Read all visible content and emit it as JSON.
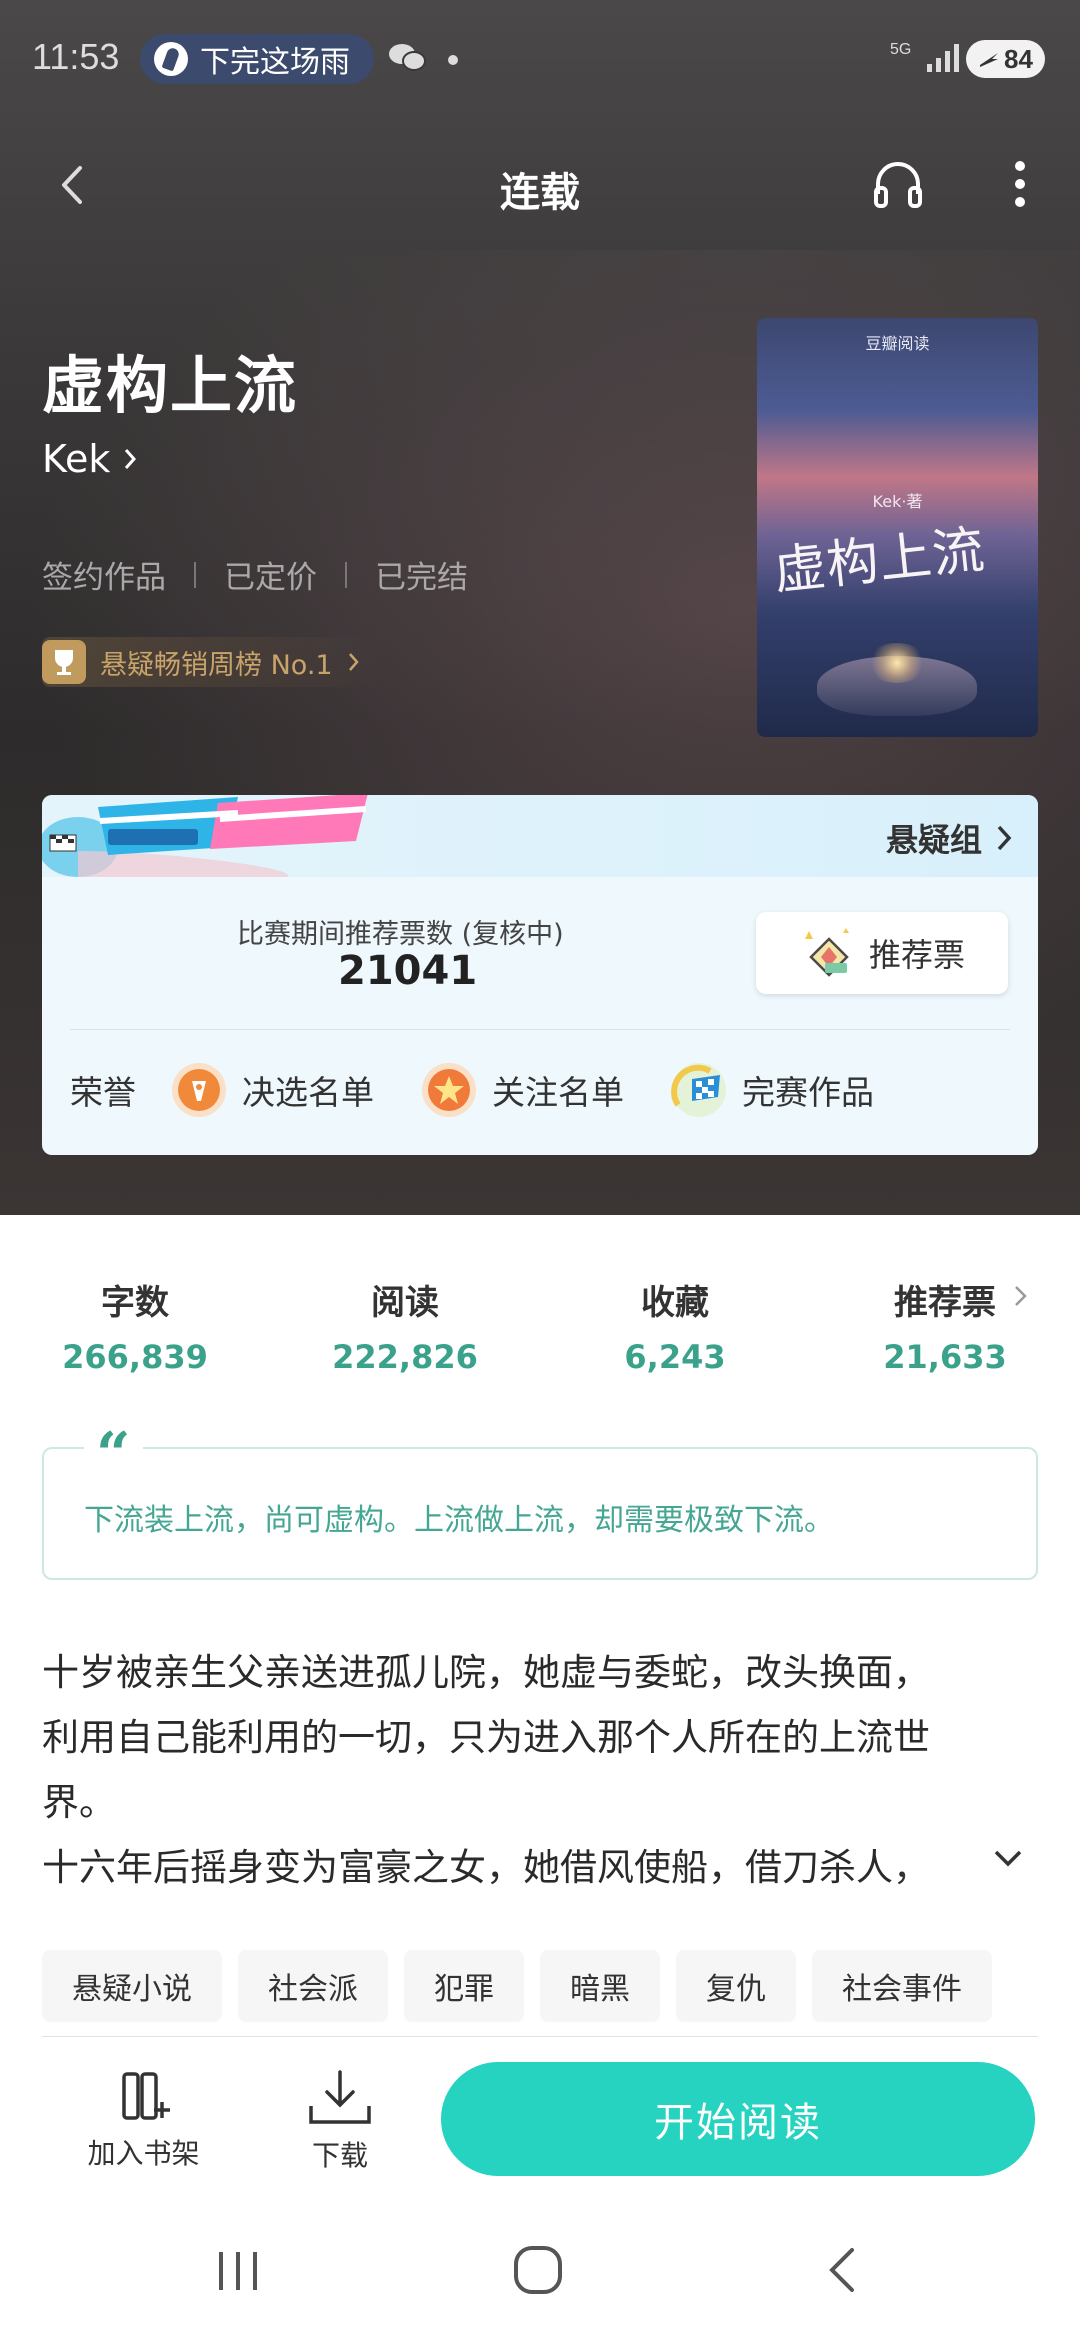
{
  "status_bar": {
    "time": "11:53",
    "now_playing": "下完这场雨",
    "network": "5G",
    "battery": "84"
  },
  "nav": {
    "title": "连载"
  },
  "book": {
    "title": "虚构上流",
    "author": "Kek",
    "meta": [
      "签约作品",
      "已定价",
      "已完结"
    ],
    "rank": "悬疑畅销周榜 No.1",
    "cover": {
      "brand": "豆瓣阅读",
      "author": "Kek·著",
      "title": "虚构上流"
    }
  },
  "contest": {
    "group": "悬疑组",
    "vote_label": "比赛期间推荐票数 (复核中)",
    "vote_count": "21041",
    "vote_button": "推荐票",
    "honors_label": "荣誉",
    "honors": [
      "决选名单",
      "关注名单",
      "完赛作品"
    ]
  },
  "stats": [
    {
      "label": "字数",
      "value": "266,839"
    },
    {
      "label": "阅读",
      "value": "222,826"
    },
    {
      "label": "收藏",
      "value": "6,243"
    },
    {
      "label": "推荐票",
      "value": "21,633"
    }
  ],
  "quote": "下流装上流，尚可虚构。上流做上流，却需要极致下流。",
  "synopsis": [
    "十岁被亲生父亲送进孤儿院，她虚与委蛇，改头换面，",
    "利用自己能利用的一切，只为进入那个人所在的上流世",
    "界。",
    "十六年后摇身变为富豪之女，她借风使船，借刀杀人，"
  ],
  "tags": [
    "悬疑小说",
    "社会派",
    "犯罪",
    "暗黑",
    "复仇",
    "社会事件"
  ],
  "actions": {
    "add_shelf": "加入书架",
    "download": "下载",
    "start_reading": "开始阅读"
  },
  "colors": {
    "accent": "#26d2c0",
    "stat_value": "#3aa18b",
    "gold": "#c9a46a"
  }
}
